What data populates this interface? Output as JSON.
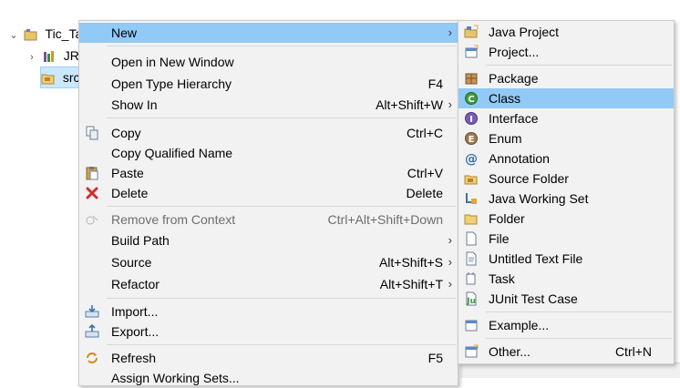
{
  "explorer": {
    "project_label": "Tic_Ta",
    "jre_label": "JRE",
    "src_label": "src"
  },
  "context_menu": {
    "items": [
      {
        "label": "New",
        "accel": "",
        "submenu": true,
        "highlighted": true,
        "icon": ""
      },
      {
        "label": "Open in New Window",
        "accel": ""
      },
      {
        "label": "Open Type Hierarchy",
        "accel": "F4"
      },
      {
        "label": "Show In",
        "accel": "Alt+Shift+W",
        "submenu": true
      },
      {
        "label": "Copy",
        "accel": "Ctrl+C",
        "icon": "copy-icon"
      },
      {
        "label": "Copy Qualified Name",
        "accel": ""
      },
      {
        "label": "Paste",
        "accel": "Ctrl+V",
        "icon": "paste-icon"
      },
      {
        "label": "Delete",
        "accel": "Delete",
        "icon": "delete-icon"
      },
      {
        "label": "Remove from Context",
        "accel": "Ctrl+Alt+Shift+Down",
        "disabled": true,
        "icon": "remove-context-icon"
      },
      {
        "label": "Build Path",
        "accel": "",
        "submenu": true
      },
      {
        "label": "Source",
        "accel": "Alt+Shift+S",
        "submenu": true
      },
      {
        "label": "Refactor",
        "accel": "Alt+Shift+T",
        "submenu": true
      },
      {
        "label": "Import...",
        "accel": "",
        "icon": "import-icon"
      },
      {
        "label": "Export...",
        "accel": "",
        "icon": "export-icon"
      },
      {
        "label": "Refresh",
        "accel": "F5",
        "icon": "refresh-icon"
      },
      {
        "label": "Assign Working Sets...",
        "accel": ""
      }
    ]
  },
  "new_submenu": {
    "items": [
      {
        "label": "Java Project",
        "icon": "java-project-icon"
      },
      {
        "label": "Project...",
        "icon": "project-icon"
      },
      {
        "label": "Package",
        "icon": "package-icon"
      },
      {
        "label": "Class",
        "icon": "class-icon",
        "highlighted": true
      },
      {
        "label": "Interface",
        "icon": "interface-icon"
      },
      {
        "label": "Enum",
        "icon": "enum-icon"
      },
      {
        "label": "Annotation",
        "icon": "annotation-icon"
      },
      {
        "label": "Source Folder",
        "icon": "source-folder-icon"
      },
      {
        "label": "Java Working Set",
        "icon": "working-set-icon"
      },
      {
        "label": "Folder",
        "icon": "folder-icon"
      },
      {
        "label": "File",
        "icon": "file-icon"
      },
      {
        "label": "Untitled Text File",
        "icon": "text-file-icon"
      },
      {
        "label": "Task",
        "icon": "task-icon"
      },
      {
        "label": "JUnit Test Case",
        "icon": "junit-icon"
      },
      {
        "label": "Example...",
        "icon": "example-icon"
      },
      {
        "label": "Other...",
        "accel": "Ctrl+N",
        "icon": "other-icon"
      }
    ]
  },
  "colors": {
    "highlight": "#91c9f7",
    "menu_bg": "#f2f2f2",
    "class_icon": "#3c9b3c",
    "interface_icon": "#7a5bb5",
    "enum_icon": "#a0784b"
  }
}
